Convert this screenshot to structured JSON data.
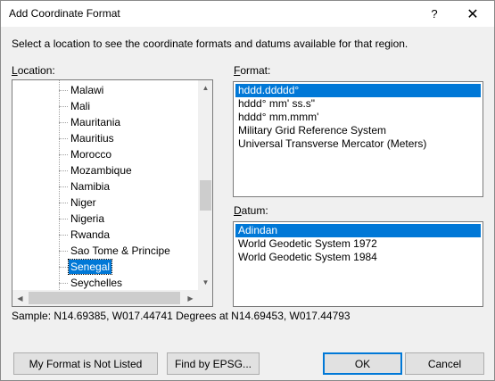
{
  "window": {
    "title": "Add Coordinate Format",
    "help_glyph": "?",
    "close_glyph": "✕"
  },
  "instruction": "Select a location to see the coordinate formats and datums available for that region.",
  "location": {
    "label_accel": "L",
    "label_rest": "ocation:",
    "items": [
      {
        "label": "Malawi",
        "selected": false
      },
      {
        "label": "Mali",
        "selected": false
      },
      {
        "label": "Mauritania",
        "selected": false
      },
      {
        "label": "Mauritius",
        "selected": false
      },
      {
        "label": "Morocco",
        "selected": false
      },
      {
        "label": "Mozambique",
        "selected": false
      },
      {
        "label": "Namibia",
        "selected": false
      },
      {
        "label": "Niger",
        "selected": false
      },
      {
        "label": "Nigeria",
        "selected": false
      },
      {
        "label": "Rwanda",
        "selected": false
      },
      {
        "label": "Sao Tome & Principe",
        "selected": false
      },
      {
        "label": "Senegal",
        "selected": true
      },
      {
        "label": "Seychelles",
        "selected": false
      }
    ],
    "scroll_up_glyph": "▲",
    "scroll_down_glyph": "▼",
    "scroll_left_glyph": "◀",
    "scroll_right_glyph": "▶"
  },
  "format": {
    "label_accel": "F",
    "label_rest": "ormat:",
    "items": [
      {
        "label": "hddd.ddddd°",
        "selected": true
      },
      {
        "label": "hddd° mm' ss.s\"",
        "selected": false
      },
      {
        "label": "hddd° mm.mmm'",
        "selected": false
      },
      {
        "label": "Military Grid Reference System",
        "selected": false
      },
      {
        "label": "Universal Transverse Mercator (Meters)",
        "selected": false
      }
    ]
  },
  "datum": {
    "label_accel": "D",
    "label_rest": "atum:",
    "items": [
      {
        "label": "Adindan",
        "selected": true
      },
      {
        "label": "World Geodetic System 1972",
        "selected": false
      },
      {
        "label": "World Geodetic System 1984",
        "selected": false
      }
    ]
  },
  "sample_text": "Sample: N14.69385, W017.44741 Degrees at N14.69453, W017.44793",
  "buttons": {
    "not_listed": "My Format is Not Listed",
    "find_epsg": "Find by EPSG...",
    "ok": "OK",
    "cancel": "Cancel"
  }
}
